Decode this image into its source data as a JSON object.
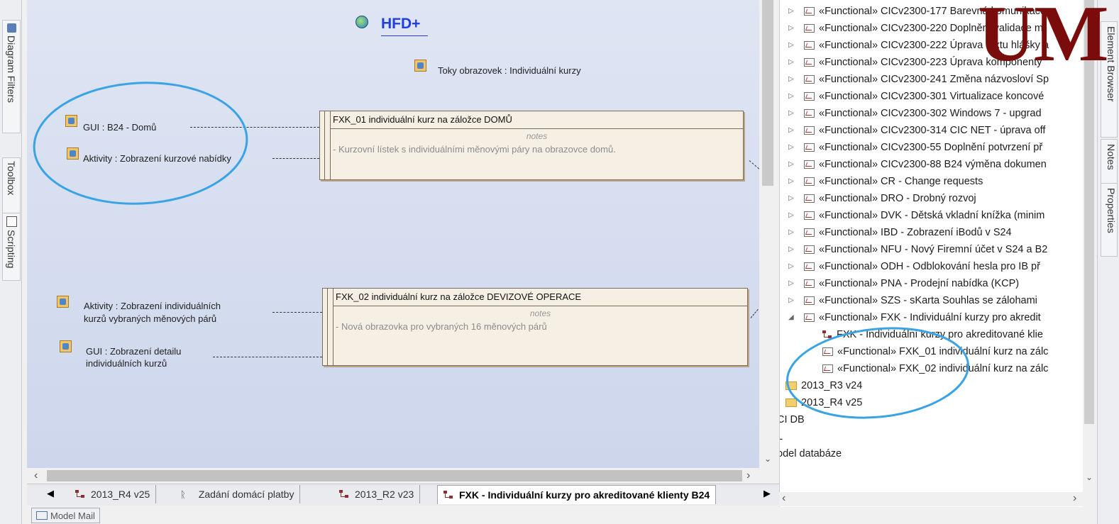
{
  "left_toolbar": {
    "tabs": [
      {
        "label": "Diagram Filters",
        "icon": "diagram-filters-icon"
      },
      {
        "label": "Toolbox",
        "icon": "none"
      },
      {
        "label": "Scripting",
        "icon": "scripting-icon"
      }
    ]
  },
  "diagram": {
    "title": "HFD+",
    "subtitle_link": "Toky obrazovek : Individuální kurzy",
    "elements": {
      "gui_domu": "GUI : B24 - Domů",
      "aktivity_zobrazeni": "Aktivity : Zobrazení kurzové nabídky",
      "aktivity_indiv_line1": "Aktivity : Zobrazení individuálních",
      "aktivity_indiv_line2": "kurzů vybraných měnových párů",
      "gui_detail_line1": "GUI : Zobrazení detailu",
      "gui_detail_line2": "individuálních kurzů"
    },
    "notes": [
      {
        "title": "FXK_01 individuální kurz na záložce DOMŮ",
        "label": "notes",
        "body": "- Kurzovní lístek s individuálními měnovými páry na obrazovce domů."
      },
      {
        "title": "FXK_02 individuální kurz na záložce DEVIZOVÉ OPERACE",
        "label": "notes",
        "body": "- Nová obrazovka pro vybraných 16 měnových párů"
      }
    ]
  },
  "tabs": [
    {
      "label": "2013_R4 v25",
      "icon": "diagram-icon",
      "active": false
    },
    {
      "label": "Zadání domácí platby",
      "icon": "activity-diagram-icon",
      "active": false
    },
    {
      "label": "2013_R2 v23",
      "icon": "diagram-icon",
      "active": false
    },
    {
      "label": "FXK - Individuální kurzy pro akreditované klienty B24",
      "icon": "diagram-icon",
      "active": true
    }
  ],
  "model_mail": "Model Mail",
  "tree": {
    "items": [
      {
        "label": "«Functional» CICv2300-177 Barevná komunikace",
        "expander": "▷",
        "icon": "functional"
      },
      {
        "label": "«Functional» CICv2300-220 Doplnění validace m",
        "expander": "▷",
        "icon": "functional"
      },
      {
        "label": "«Functional» CICv2300-222 Úprava textu hlášky a",
        "expander": "▷",
        "icon": "functional"
      },
      {
        "label": "«Functional» CICv2300-223 Úprava komponenty",
        "expander": "▷",
        "icon": "functional"
      },
      {
        "label": "«Functional» CICv2300-241 Změna názvosloví Sp",
        "expander": "▷",
        "icon": "functional"
      },
      {
        "label": "«Functional» CICv2300-301 Virtualizace koncové",
        "expander": "▷",
        "icon": "functional"
      },
      {
        "label": "«Functional» CICv2300-302 Windows 7 - upgrad",
        "expander": "▷",
        "icon": "functional"
      },
      {
        "label": "«Functional» CICv2300-314 CIC NET - úprava off",
        "expander": "▷",
        "icon": "functional"
      },
      {
        "label": "«Functional» CICv2300-55 Doplnění potvrzení př",
        "expander": "▷",
        "icon": "functional"
      },
      {
        "label": "«Functional» CICv2300-88 B24 výměna dokumen",
        "expander": "▷",
        "icon": "functional"
      },
      {
        "label": "«Functional» CR - Change requests",
        "expander": "▷",
        "icon": "functional"
      },
      {
        "label": "«Functional» DRO - Drobný rozvoj",
        "expander": "▷",
        "icon": "functional"
      },
      {
        "label": "«Functional» DVK - Dětská vkladní knížka (minim",
        "expander": "▷",
        "icon": "functional"
      },
      {
        "label": "«Functional» IBD - Zobrazení iBodů v S24",
        "expander": "▷",
        "icon": "functional"
      },
      {
        "label": "«Functional» NFU - Nový Firemní účet v S24 a B2",
        "expander": "▷",
        "icon": "functional"
      },
      {
        "label": "«Functional» ODH - Odblokování hesla pro IB př",
        "expander": "▷",
        "icon": "functional"
      },
      {
        "label": "«Functional» PNA - Prodejní nabídka (KCP)",
        "expander": "▷",
        "icon": "functional"
      },
      {
        "label": "«Functional» SZS - sKarta Souhlas se zálohami",
        "expander": "▷",
        "icon": "functional"
      },
      {
        "label": "«Functional» FXK - Individuální kurzy pro akredit",
        "expander": "◢",
        "icon": "functional"
      },
      {
        "label": "FXK - Individuální kurzy pro akreditované klie",
        "expander": "",
        "icon": "diagram"
      },
      {
        "label": "«Functional» FXK_01 individuální kurz na zálc",
        "expander": "",
        "icon": "functional"
      },
      {
        "label": "«Functional» FXK_02 individuální kurz na zálc",
        "expander": "",
        "icon": "functional"
      },
      {
        "label": "2013_R3 v24",
        "expander": "",
        "icon": "folder"
      },
      {
        "label": "2013_R4 v25",
        "expander": "",
        "icon": "folder"
      },
      {
        "label": "CI DB",
        "expander": "",
        "icon": "none"
      },
      {
        "label": "L",
        "expander": "",
        "icon": "none"
      },
      {
        "label": "odel databáze",
        "expander": "",
        "icon": "none"
      }
    ]
  },
  "right_toolbar": {
    "tabs": [
      {
        "label": "Element Browser"
      },
      {
        "label": "Notes"
      },
      {
        "label": "Properties"
      }
    ]
  },
  "watermark": "UM",
  "colors": {
    "annotation_circle": "#3aa3e3",
    "link_blue": "#1f3fe0",
    "watermark": "#7a0c0c"
  }
}
